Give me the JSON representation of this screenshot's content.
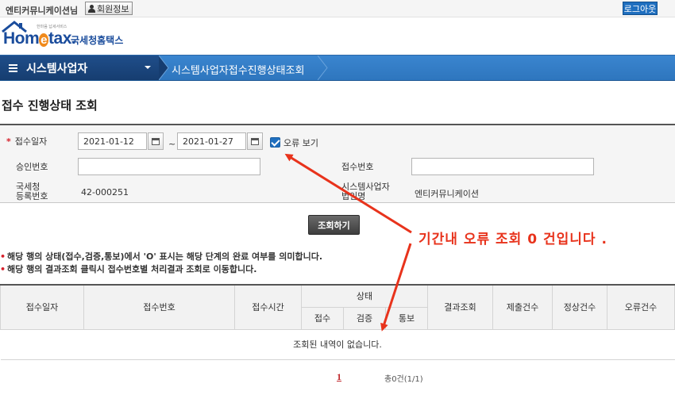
{
  "topbar": {
    "user_name": "엔티커뮤니케이션님",
    "member_info_label": "회원정보",
    "logout_label": "로그아웃"
  },
  "logo": {
    "slogan": "한마음 납세서비스",
    "brand_en": "Hometax",
    "brand_kr": "국세청홈택스"
  },
  "nav": {
    "main_menu": "시스템사업자",
    "breadcrumb": "시스템사업자접수진행상태조회"
  },
  "page": {
    "title": "접수 진행상태 조회"
  },
  "form": {
    "receipt_date_label": "접수일자",
    "required_mark": "*",
    "date_from": "2021-01-12",
    "date_to": "2021-01-27",
    "tilde": "~",
    "error_view_label": "오류 보기",
    "error_view_checked": true,
    "approval_no_label": "승인번호",
    "approval_no_value": "",
    "receipt_no_label": "접수번호",
    "receipt_no_value": "",
    "tax_reg_label_1": "국세청",
    "tax_reg_label_2": "등록번호",
    "tax_reg_value": "42-000251",
    "corp_name_label_1": "시스템사업자",
    "corp_name_label_2": "법인명",
    "corp_name_value": "엔티커뮤니케이션"
  },
  "query_button": "조회하기",
  "notes": [
    "해당 행의 상태(접수,검증,통보)에서 'O' 표시는 해당 단계의 완료 여부를 의미합니다.",
    "해당 행의 결과조회 클릭시 접수번호별 처리결과 조회로 이동합니다."
  ],
  "annotation": "기간내 오류 조회 0 건입니다 .",
  "table": {
    "headers": {
      "receipt_date": "접수일자",
      "receipt_no": "접수번호",
      "receipt_time": "접수시간",
      "status": "상태",
      "status_receipt": "접수",
      "status_verify": "검증",
      "status_notify": "통보",
      "result": "결과조회",
      "submit_count": "제출건수",
      "normal_count": "정상건수",
      "error_count": "오류건수"
    },
    "empty_message": "조회된 내역이 없습니다."
  },
  "paging": {
    "current_page": "1",
    "total": "총0건(1/1)"
  },
  "colors": {
    "nav_blue": "#2e76be",
    "nav_dark": "#1f4e8a",
    "accent_red": "#e8331c",
    "logout_blue": "#1f6fbf"
  }
}
